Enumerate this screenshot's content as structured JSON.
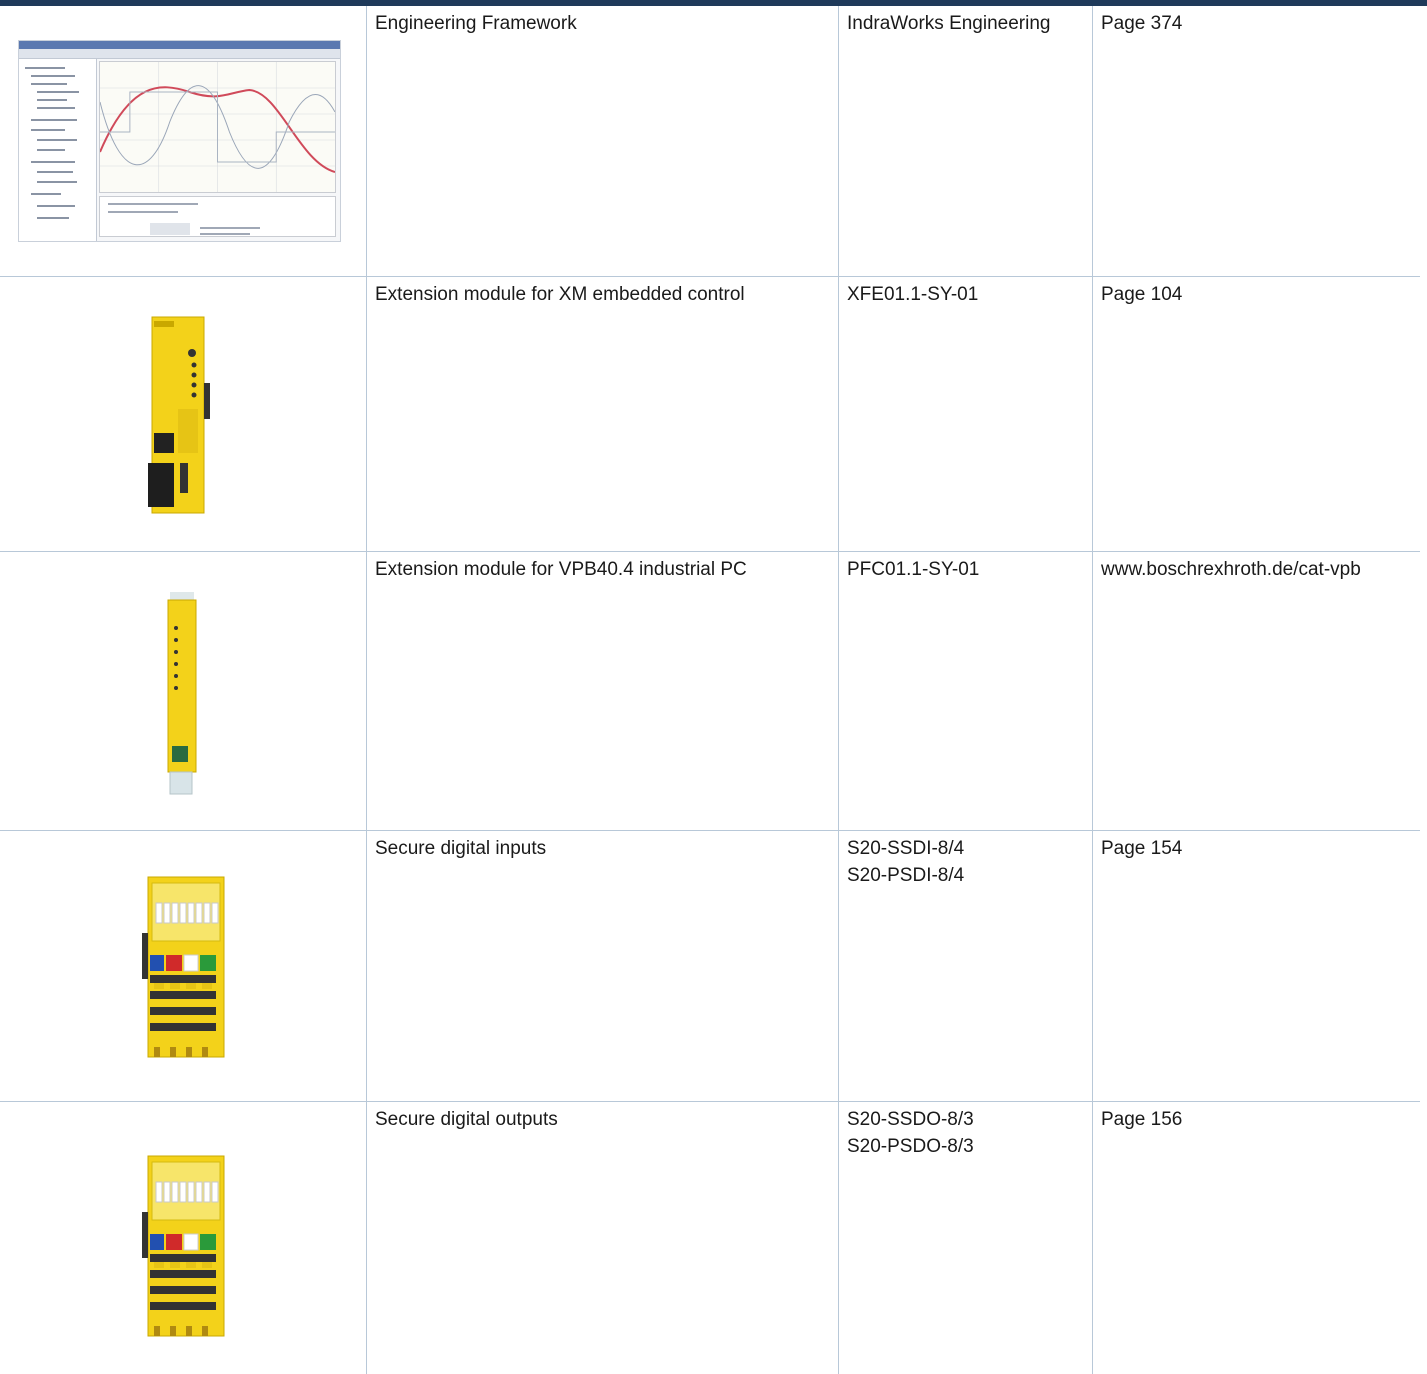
{
  "colors": {
    "accent_bar": "#1f3a5a",
    "grid_line": "#b8c8d8",
    "module_yellow": "#f3d21a"
  },
  "rows": [
    {
      "image": "engineering-software-screenshot",
      "description": "Engineering Framework",
      "type_lines": [
        "IndraWorks Engineering"
      ],
      "reference": "Page 374"
    },
    {
      "image": "xfe-extension-module-photo",
      "description": "Extension module for XM embedded control",
      "type_lines": [
        "XFE01.1-SY-01"
      ],
      "reference": "Page 104"
    },
    {
      "image": "pfc-extension-card-photo",
      "description": "Extension module for VPB40.4 industrial PC",
      "type_lines": [
        "PFC01.1-SY-01"
      ],
      "reference": "www.boschrexhroth.de/cat-vpb"
    },
    {
      "image": "s20-input-module-photo",
      "description": "Secure digital inputs",
      "type_lines": [
        "S20-SSDI-8/4",
        "S20-PSDI-8/4"
      ],
      "reference": "Page 154"
    },
    {
      "image": "s20-output-module-photo",
      "description": "Secure digital outputs",
      "type_lines": [
        "S20-SSDO-8/3",
        "S20-PSDO-8/3"
      ],
      "reference": "Page 156"
    }
  ]
}
